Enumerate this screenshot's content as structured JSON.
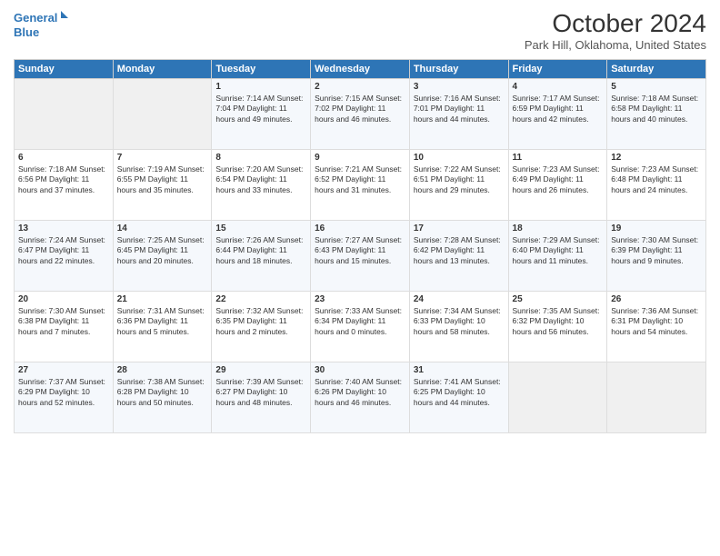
{
  "header": {
    "logo_line1": "General",
    "logo_line2": "Blue",
    "month": "October 2024",
    "location": "Park Hill, Oklahoma, United States"
  },
  "days_of_week": [
    "Sunday",
    "Monday",
    "Tuesday",
    "Wednesday",
    "Thursday",
    "Friday",
    "Saturday"
  ],
  "weeks": [
    [
      {
        "day": "",
        "content": ""
      },
      {
        "day": "",
        "content": ""
      },
      {
        "day": "1",
        "content": "Sunrise: 7:14 AM\nSunset: 7:04 PM\nDaylight: 11 hours and 49 minutes."
      },
      {
        "day": "2",
        "content": "Sunrise: 7:15 AM\nSunset: 7:02 PM\nDaylight: 11 hours and 46 minutes."
      },
      {
        "day": "3",
        "content": "Sunrise: 7:16 AM\nSunset: 7:01 PM\nDaylight: 11 hours and 44 minutes."
      },
      {
        "day": "4",
        "content": "Sunrise: 7:17 AM\nSunset: 6:59 PM\nDaylight: 11 hours and 42 minutes."
      },
      {
        "day": "5",
        "content": "Sunrise: 7:18 AM\nSunset: 6:58 PM\nDaylight: 11 hours and 40 minutes."
      }
    ],
    [
      {
        "day": "6",
        "content": "Sunrise: 7:18 AM\nSunset: 6:56 PM\nDaylight: 11 hours and 37 minutes."
      },
      {
        "day": "7",
        "content": "Sunrise: 7:19 AM\nSunset: 6:55 PM\nDaylight: 11 hours and 35 minutes."
      },
      {
        "day": "8",
        "content": "Sunrise: 7:20 AM\nSunset: 6:54 PM\nDaylight: 11 hours and 33 minutes."
      },
      {
        "day": "9",
        "content": "Sunrise: 7:21 AM\nSunset: 6:52 PM\nDaylight: 11 hours and 31 minutes."
      },
      {
        "day": "10",
        "content": "Sunrise: 7:22 AM\nSunset: 6:51 PM\nDaylight: 11 hours and 29 minutes."
      },
      {
        "day": "11",
        "content": "Sunrise: 7:23 AM\nSunset: 6:49 PM\nDaylight: 11 hours and 26 minutes."
      },
      {
        "day": "12",
        "content": "Sunrise: 7:23 AM\nSunset: 6:48 PM\nDaylight: 11 hours and 24 minutes."
      }
    ],
    [
      {
        "day": "13",
        "content": "Sunrise: 7:24 AM\nSunset: 6:47 PM\nDaylight: 11 hours and 22 minutes."
      },
      {
        "day": "14",
        "content": "Sunrise: 7:25 AM\nSunset: 6:45 PM\nDaylight: 11 hours and 20 minutes."
      },
      {
        "day": "15",
        "content": "Sunrise: 7:26 AM\nSunset: 6:44 PM\nDaylight: 11 hours and 18 minutes."
      },
      {
        "day": "16",
        "content": "Sunrise: 7:27 AM\nSunset: 6:43 PM\nDaylight: 11 hours and 15 minutes."
      },
      {
        "day": "17",
        "content": "Sunrise: 7:28 AM\nSunset: 6:42 PM\nDaylight: 11 hours and 13 minutes."
      },
      {
        "day": "18",
        "content": "Sunrise: 7:29 AM\nSunset: 6:40 PM\nDaylight: 11 hours and 11 minutes."
      },
      {
        "day": "19",
        "content": "Sunrise: 7:30 AM\nSunset: 6:39 PM\nDaylight: 11 hours and 9 minutes."
      }
    ],
    [
      {
        "day": "20",
        "content": "Sunrise: 7:30 AM\nSunset: 6:38 PM\nDaylight: 11 hours and 7 minutes."
      },
      {
        "day": "21",
        "content": "Sunrise: 7:31 AM\nSunset: 6:36 PM\nDaylight: 11 hours and 5 minutes."
      },
      {
        "day": "22",
        "content": "Sunrise: 7:32 AM\nSunset: 6:35 PM\nDaylight: 11 hours and 2 minutes."
      },
      {
        "day": "23",
        "content": "Sunrise: 7:33 AM\nSunset: 6:34 PM\nDaylight: 11 hours and 0 minutes."
      },
      {
        "day": "24",
        "content": "Sunrise: 7:34 AM\nSunset: 6:33 PM\nDaylight: 10 hours and 58 minutes."
      },
      {
        "day": "25",
        "content": "Sunrise: 7:35 AM\nSunset: 6:32 PM\nDaylight: 10 hours and 56 minutes."
      },
      {
        "day": "26",
        "content": "Sunrise: 7:36 AM\nSunset: 6:31 PM\nDaylight: 10 hours and 54 minutes."
      }
    ],
    [
      {
        "day": "27",
        "content": "Sunrise: 7:37 AM\nSunset: 6:29 PM\nDaylight: 10 hours and 52 minutes."
      },
      {
        "day": "28",
        "content": "Sunrise: 7:38 AM\nSunset: 6:28 PM\nDaylight: 10 hours and 50 minutes."
      },
      {
        "day": "29",
        "content": "Sunrise: 7:39 AM\nSunset: 6:27 PM\nDaylight: 10 hours and 48 minutes."
      },
      {
        "day": "30",
        "content": "Sunrise: 7:40 AM\nSunset: 6:26 PM\nDaylight: 10 hours and 46 minutes."
      },
      {
        "day": "31",
        "content": "Sunrise: 7:41 AM\nSunset: 6:25 PM\nDaylight: 10 hours and 44 minutes."
      },
      {
        "day": "",
        "content": ""
      },
      {
        "day": "",
        "content": ""
      }
    ]
  ]
}
